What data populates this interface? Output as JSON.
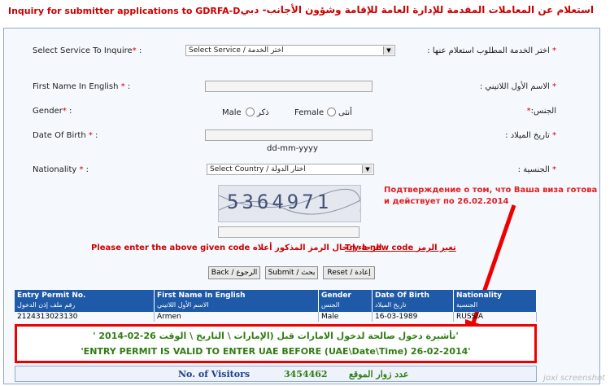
{
  "header": {
    "title_en": "Inquiry for submitter applications to GDRFA-D",
    "title_ar": "استعلام عن المعاملات المقدمة للإدارة العامة للإقامة وشؤون الأجانب- دبي"
  },
  "form": {
    "service": {
      "label_en": "Select Service To Inquire",
      "label_ar": "اختر الخدمة المطلوب استعلام عنها :",
      "value": "Select Service / اختر الخدمة"
    },
    "first_name": {
      "label_en": "First Name In English",
      "label_ar": "الاسم الأول اللاتيني :"
    },
    "gender": {
      "label_en": "Gender",
      "label_ar": "الجنس:",
      "male": "Male",
      "male_ar": "ذكر",
      "female": "Female",
      "female_ar": "أنثى"
    },
    "dob": {
      "label_en": "Date Of Birth",
      "label_ar": "تاريخ الميلاد :",
      "hint": "dd-mm-yyyy"
    },
    "nationality": {
      "label_en": "Nationality",
      "label_ar": "الجنسية :",
      "value": "Select Country / اختار الدولة"
    },
    "captcha": {
      "code": "5364971",
      "prompt_en": "Please enter the above given code",
      "prompt_ar": "الرجاء إدخال الرمز المذكور أعلاه",
      "new_code_en": "Try a new code",
      "new_code_ar": "تغير الرمز"
    },
    "buttons": {
      "back": "Back / الرجوع",
      "submit": "Submit / بحث",
      "reset": "Reset / إعادة"
    }
  },
  "annotation": "Подтверждение о том, что Ваша виза готова и действует по 26.02.2014",
  "results": {
    "headers": [
      {
        "en": "Entry Permit No.",
        "ar": "رقم ملف إذن الدخول"
      },
      {
        "en": "First Name In English",
        "ar": "الاسم الأول اللاتيني"
      },
      {
        "en": "Gender",
        "ar": "الجنس"
      },
      {
        "en": "Date Of Birth",
        "ar": "تاريخ الميلاد"
      },
      {
        "en": "Nationality",
        "ar": "الجنسية"
      }
    ],
    "row": [
      "2124313023130",
      "Armen",
      "Male",
      "16-03-1989",
      "RUSSIA"
    ],
    "permit_ar": "'تأشيرة دخول صالحة لدخول الامارات قبل (الإمارات \\ التاريخ \\ الوقت 26-02-2014 '",
    "permit_en": "'ENTRY PERMIT IS VALID TO ENTER UAE BEFORE (UAE\\Date\\Time)  26-02-2014'",
    "visitors_label": "No. of Visitors",
    "visitors_count": "3454462",
    "visitors_ar": "عدد زوار الموقع"
  },
  "watermark": "joxi screenshot"
}
